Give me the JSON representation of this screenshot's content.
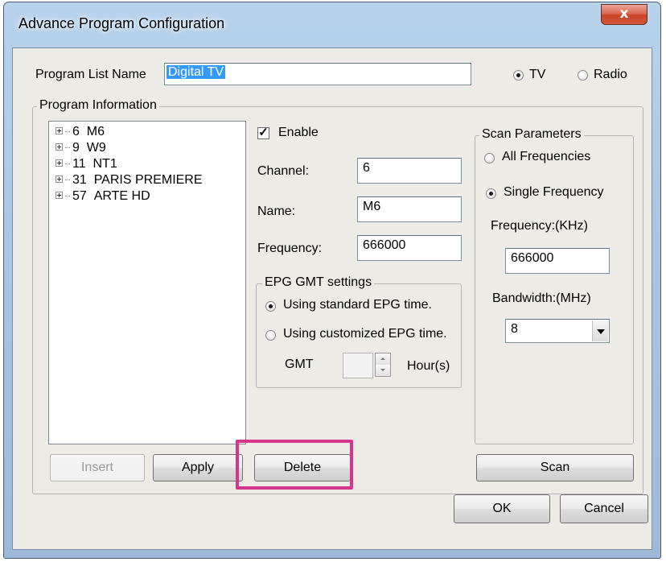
{
  "window": {
    "title": "Advance Program Configuration",
    "close_label": "x"
  },
  "program_list": {
    "label": "Program List Name",
    "value": "Digital TV",
    "type_options": [
      {
        "label": "TV",
        "selected": true
      },
      {
        "label": "Radio",
        "selected": false
      }
    ]
  },
  "program_info": {
    "legend": "Program Information",
    "channels": [
      {
        "number": "6",
        "name": "M6"
      },
      {
        "number": "9",
        "name": "W9"
      },
      {
        "number": "11",
        "name": "NT1"
      },
      {
        "number": "31",
        "name": "PARIS PREMIERE"
      },
      {
        "number": "57",
        "name": "ARTE HD"
      }
    ],
    "enable_label": "Enable",
    "enable_checked": true,
    "channel_label": "Channel:",
    "channel_value": "6",
    "name_label": "Name:",
    "name_value": "M6",
    "frequency_label": "Frequency:",
    "frequency_value": "666000"
  },
  "epg": {
    "legend": "EPG GMT settings",
    "standard_label": "Using standard EPG time.",
    "standard_selected": true,
    "custom_label": "Using customized EPG time.",
    "custom_selected": false,
    "gmt_label": "GMT",
    "gmt_value": "",
    "hours_label": "Hour(s)"
  },
  "scan": {
    "legend": "Scan Parameters",
    "all_label": "All Frequencies",
    "all_selected": false,
    "single_label": "Single Frequency",
    "single_selected": true,
    "frequency_label": "Frequency:(KHz)",
    "frequency_value": "666000",
    "bandwidth_label": "Bandwidth:(MHz)",
    "bandwidth_value": "8"
  },
  "buttons": {
    "insert": "Insert",
    "apply": "Apply",
    "delete": "Delete",
    "scan": "Scan",
    "ok": "OK",
    "cancel": "Cancel"
  },
  "colors": {
    "highlight": "#d6358e",
    "selection": "#3399ff"
  }
}
